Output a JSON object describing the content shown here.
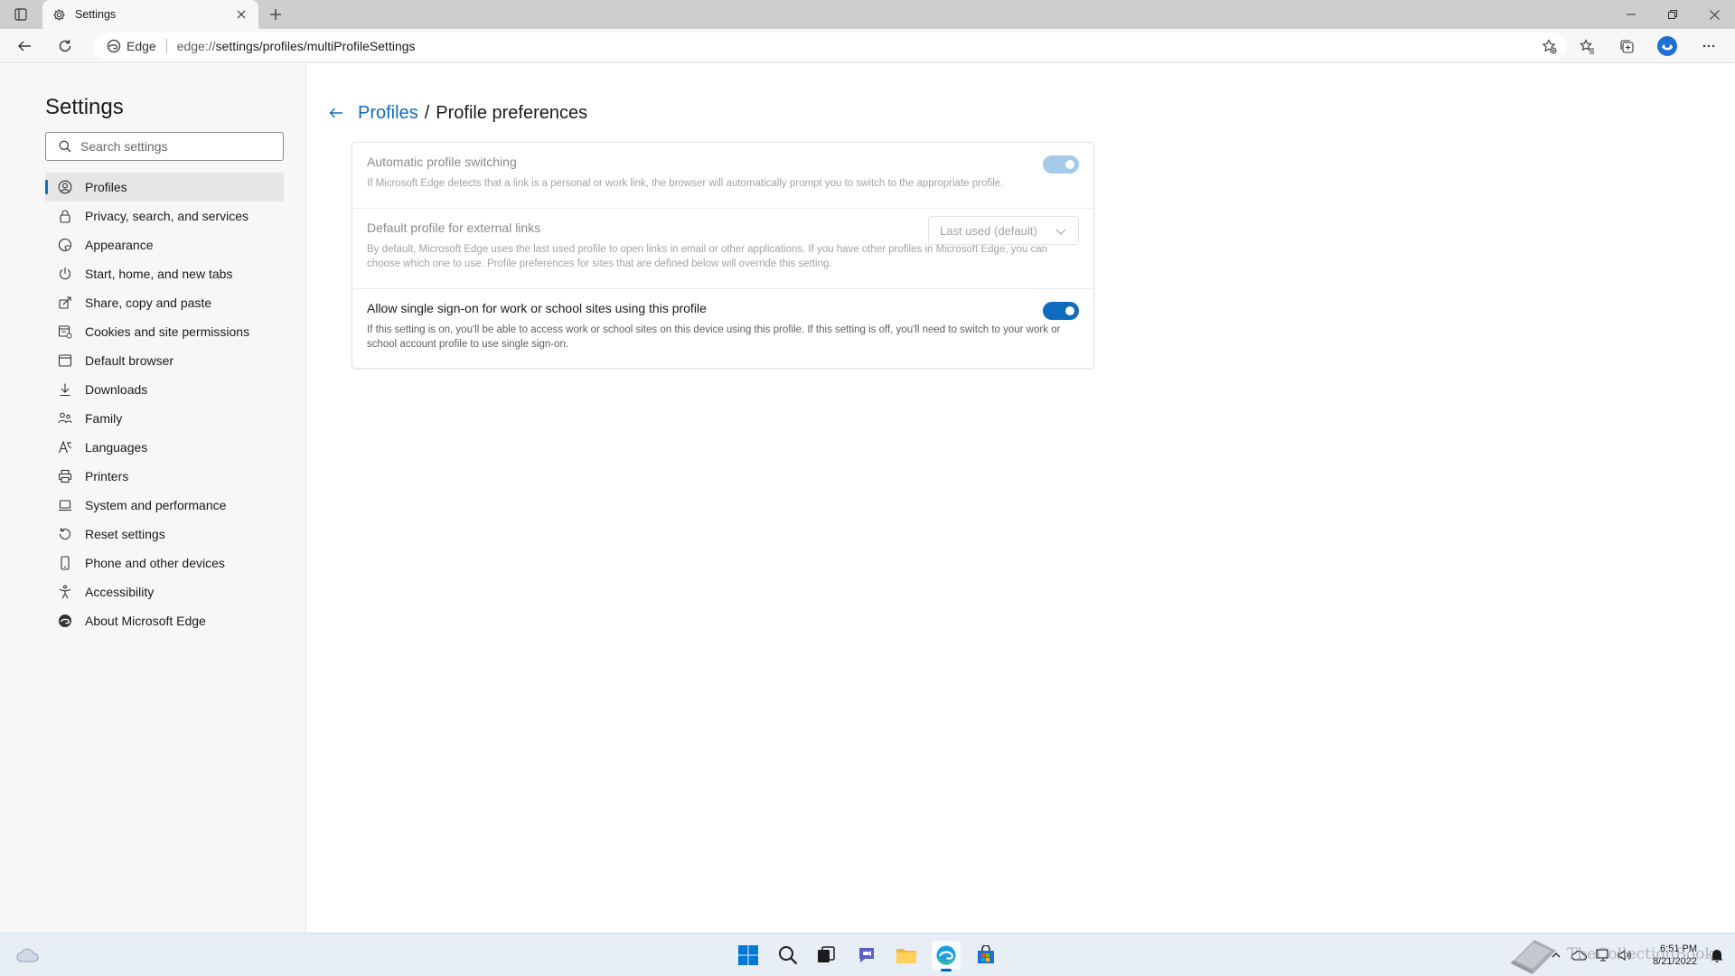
{
  "browser": {
    "tab_title": "Settings",
    "site_label": "Edge",
    "url_prefix": "edge://",
    "url_path": "settings/profiles/multiProfileSettings"
  },
  "sidebar": {
    "title": "Settings",
    "search_placeholder": "Search settings",
    "items": [
      {
        "label": "Profiles",
        "icon": "profile-icon",
        "active": true
      },
      {
        "label": "Privacy, search, and services",
        "icon": "lock-icon"
      },
      {
        "label": "Appearance",
        "icon": "appearance-icon"
      },
      {
        "label": "Start, home, and new tabs",
        "icon": "power-icon"
      },
      {
        "label": "Share, copy and paste",
        "icon": "share-icon"
      },
      {
        "label": "Cookies and site permissions",
        "icon": "site-permissions-icon"
      },
      {
        "label": "Default browser",
        "icon": "browser-icon"
      },
      {
        "label": "Downloads",
        "icon": "download-icon"
      },
      {
        "label": "Family",
        "icon": "family-icon"
      },
      {
        "label": "Languages",
        "icon": "language-icon"
      },
      {
        "label": "Printers",
        "icon": "printer-icon"
      },
      {
        "label": "System and performance",
        "icon": "laptop-icon"
      },
      {
        "label": "Reset settings",
        "icon": "reset-icon"
      },
      {
        "label": "Phone and other devices",
        "icon": "phone-icon"
      },
      {
        "label": "Accessibility",
        "icon": "accessibility-icon"
      },
      {
        "label": "About Microsoft Edge",
        "icon": "edge-logo-icon"
      }
    ]
  },
  "main": {
    "breadcrumb_parent": "Profiles",
    "breadcrumb_separator": "/",
    "breadcrumb_current": "Profile preferences",
    "settings": [
      {
        "title": "Automatic profile switching",
        "description": "If Microsoft Edge detects that a link is a personal or work link, the browser will automatically prompt you to switch to the appropriate profile.",
        "toggle_on": true,
        "disabled": true
      },
      {
        "title": "Default profile for external links",
        "description": "By default, Microsoft Edge uses the last used profile to open links in email or other applications. If you have other profiles in Microsoft Edge, you can choose which one to use. Profile preferences for sites that are defined below will override this setting.",
        "dropdown_value": "Last used (default)",
        "disabled": true
      },
      {
        "title": "Allow single sign-on for work or school sites using this profile",
        "description": "If this setting is on, you'll be able to access work or school sites on this device using this profile. If this setting is off, you'll need to switch to your work or school account profile to use single sign-on.",
        "toggle_on": true,
        "disabled": false
      }
    ]
  },
  "taskbar": {
    "time": "6:51 PM",
    "date": "8/21/2022",
    "watermark": "TheCollectionBook"
  },
  "colors": {
    "accent": "#0f6cbd",
    "toggle_disabled": "#a7c9ea"
  }
}
